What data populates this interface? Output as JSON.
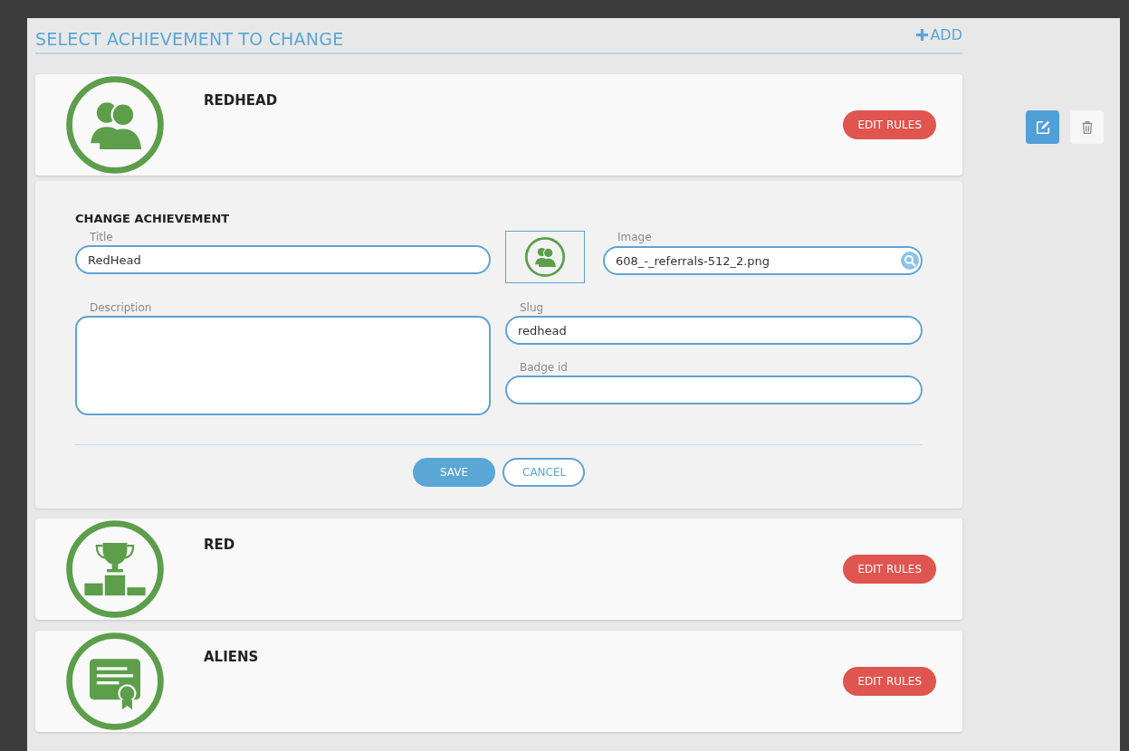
{
  "header": {
    "title": "SELECT ACHIEVEMENT TO CHANGE",
    "add_label": "ADD"
  },
  "achievements": [
    {
      "title": "REDHEAD",
      "kind": "people",
      "expanded": true,
      "button": "EDIT RULES"
    },
    {
      "title": "RED",
      "kind": "trophy",
      "expanded": false,
      "button": "EDIT RULES"
    },
    {
      "title": "ALIENS",
      "kind": "certificate",
      "expanded": false,
      "button": "EDIT RULES"
    }
  ],
  "editor": {
    "heading": "CHANGE ACHIEVEMENT",
    "title_field": {
      "label": "Title",
      "value": "RedHead"
    },
    "preview": {
      "kind": "people"
    },
    "image_field": {
      "label": "Image",
      "value": "608_-_referrals-512_2.png"
    },
    "description_field": {
      "label": "Description"
    },
    "slug_field": {
      "label": "Slug",
      "value": "redhead"
    },
    "badge_field": {
      "label": "Badge id"
    },
    "buttons": [
      {
        "kind": "primary",
        "label": "SAVE"
      },
      {
        "kind": "secondary",
        "label": "CANCEL"
      }
    ]
  },
  "side_actions": [
    {
      "kind": "edit",
      "selected": true
    },
    {
      "kind": "delete",
      "selected": false
    }
  ]
}
